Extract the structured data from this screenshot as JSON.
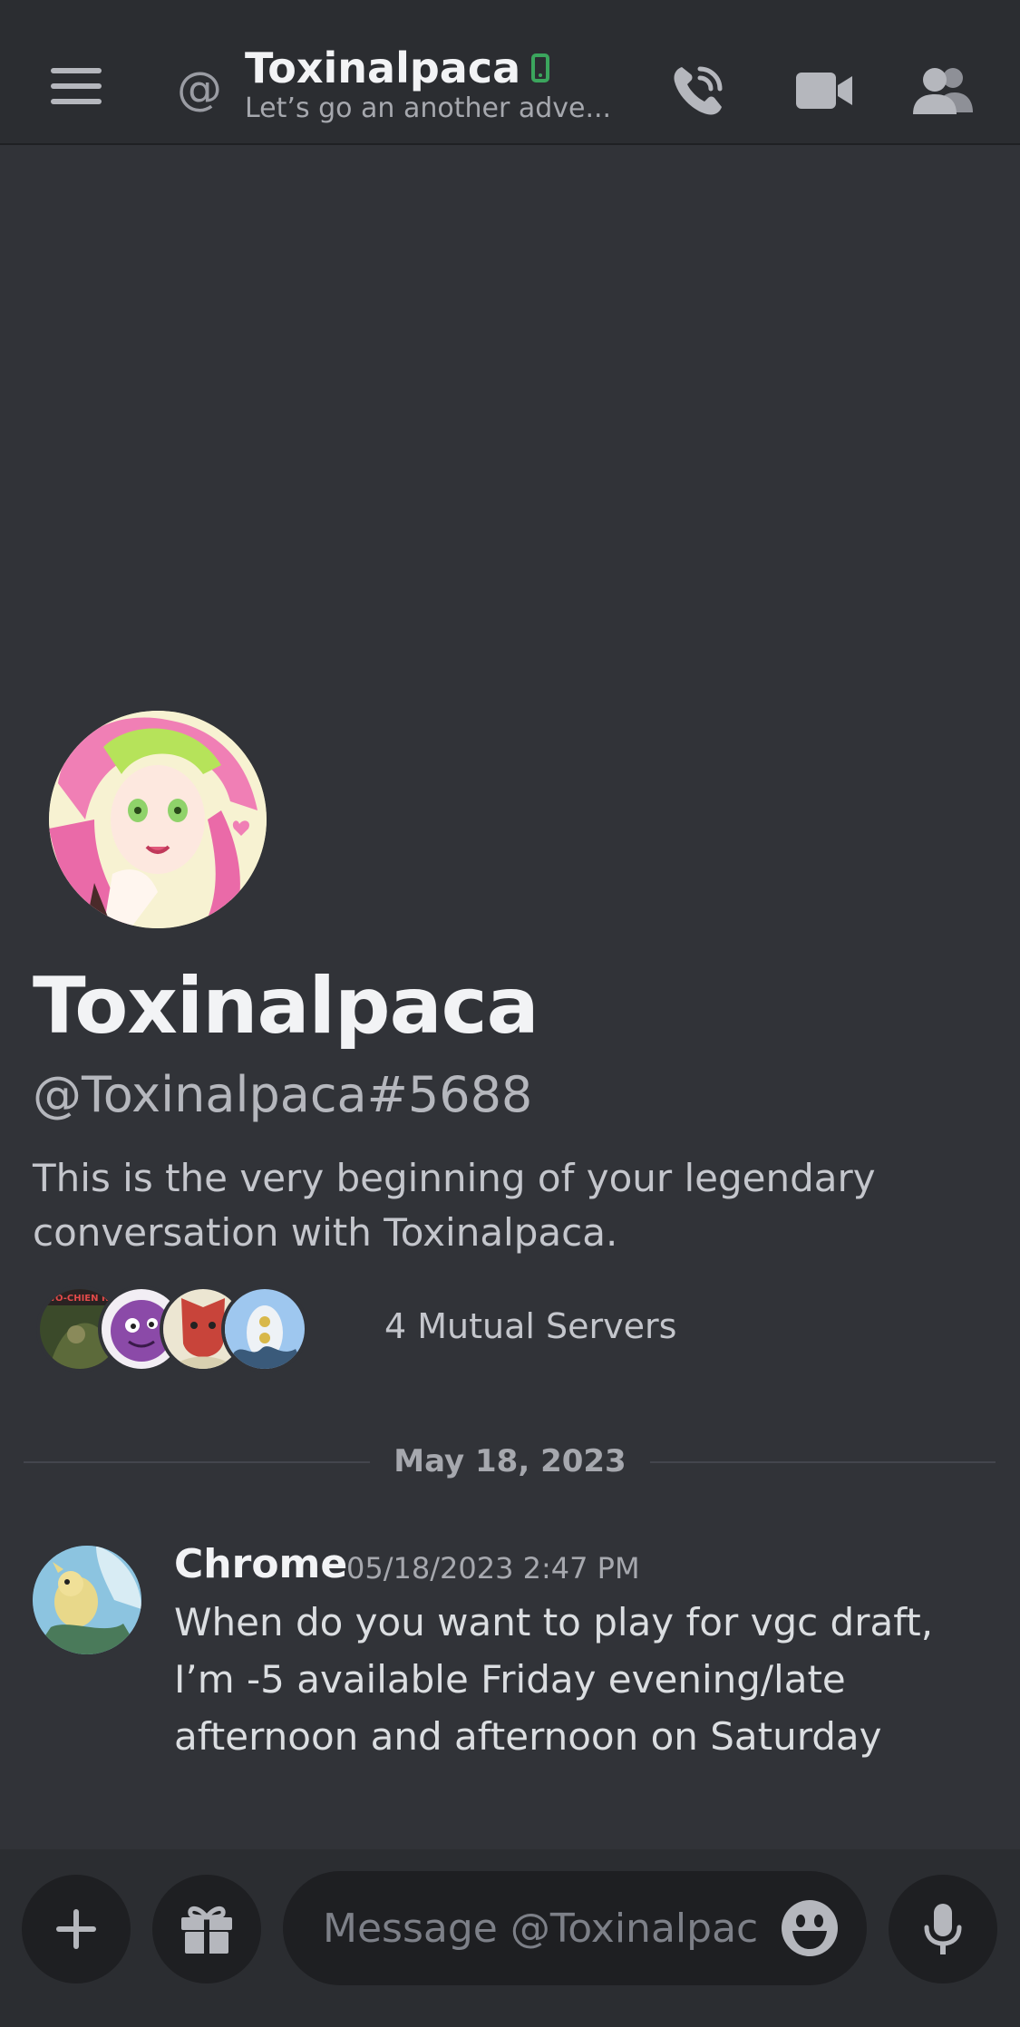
{
  "header": {
    "title": "Toxinalpaca",
    "subtitle": "Let’s go an another adve...",
    "at_symbol": "@"
  },
  "profile": {
    "display_name": "Toxinalpaca",
    "handle": "@Toxinalpaca#5688",
    "intro": "This is the very beginning of your legendary conversation with Toxinalpaca.",
    "mutual_servers": "4 Mutual Servers",
    "server_icon_text": "WO-CHIEN REF"
  },
  "date_divider": "May 18, 2023",
  "messages": [
    {
      "author": "Chrome",
      "timestamp": "05/18/2023 2:47 PM",
      "text": "When do you want to play for vgc draft, I’m -5 available Friday evening/late afternoon and afternoon on Saturday"
    }
  ],
  "composer": {
    "placeholder": "Message @Toxinalpaca"
  },
  "colors": {
    "background": "#313338",
    "header": "#2b2d31",
    "online_mobile": "#3ba55d"
  },
  "icons": {
    "menu": "hamburger-icon",
    "call": "phone-call-icon",
    "video": "video-camera-icon",
    "members": "members-icon",
    "plus": "plus-icon",
    "gift": "gift-icon",
    "emoji": "emoji-icon",
    "mic": "microphone-icon"
  }
}
